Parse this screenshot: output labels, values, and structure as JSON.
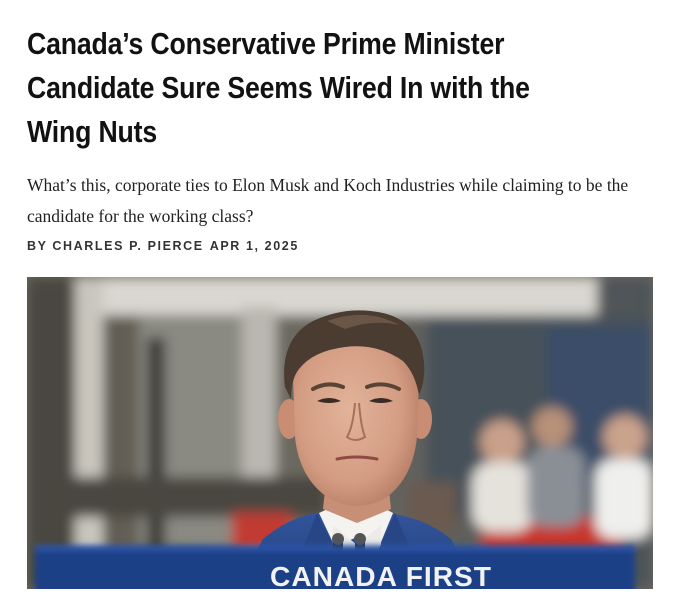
{
  "article": {
    "headline": "Canada’s Conservative Prime Minister Candidate Sure Seems Wired In with the Wing Nuts",
    "dek": "What’s this, corporate ties to Elon Musk and Koch Industries while claiming to be the candidate for the working class?",
    "byline": "BY CHARLES P. PIERCE",
    "date": "APR 1, 2025"
  },
  "photo": {
    "podium_text": "CANADA FIRST",
    "colors": {
      "podium": "#1f3f86",
      "suit": "#2a4b8f",
      "shirt": "#f4f3f0",
      "skin": "#d7a58c",
      "hair": "#4a3b30",
      "background_red": "#c8342c"
    }
  }
}
